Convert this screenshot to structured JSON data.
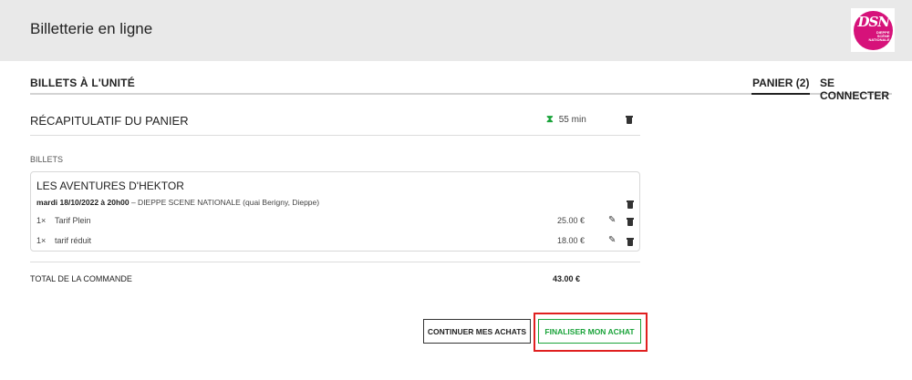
{
  "header": {
    "title": "Billetterie en ligne",
    "logo": {
      "mark": "DSN",
      "text_line1": "DIEPPE",
      "text_line2": "SCÈNE",
      "text_line3": "NATIONALE",
      "color": "#d6127a"
    }
  },
  "nav": {
    "left_label": "BILLETS À L'UNITÉ",
    "cart_label": "PANIER (2)",
    "login_label": "SE CONNECTER"
  },
  "recap": {
    "title": "RÉCAPITULATIF DU PANIER",
    "timer_icon": "hourglass-icon",
    "timer": "55 min",
    "section_label": "BILLETS"
  },
  "event": {
    "title": "LES AVENTURES D'HEKTOR",
    "date": "mardi 18/10/2022 à 20h00",
    "venue": " – DIEPPE SCENE NATIONALE (quai Berigny, Dieppe)",
    "tickets": [
      {
        "qty": "1×",
        "name": "Tarif Plein",
        "price": "25.00 €"
      },
      {
        "qty": "1×",
        "name": "tarif réduit",
        "price": "18.00 €"
      }
    ]
  },
  "total": {
    "label": "TOTAL DE LA COMMANDE",
    "value": "43.00 €"
  },
  "actions": {
    "continue_label": "CONTINUER MES ACHATS",
    "finish_label": "FINALISER MON ACHAT"
  },
  "colors": {
    "accent_green": "#1aa33a",
    "highlight_red": "#e02020",
    "header_bg": "#e9e9e9"
  }
}
